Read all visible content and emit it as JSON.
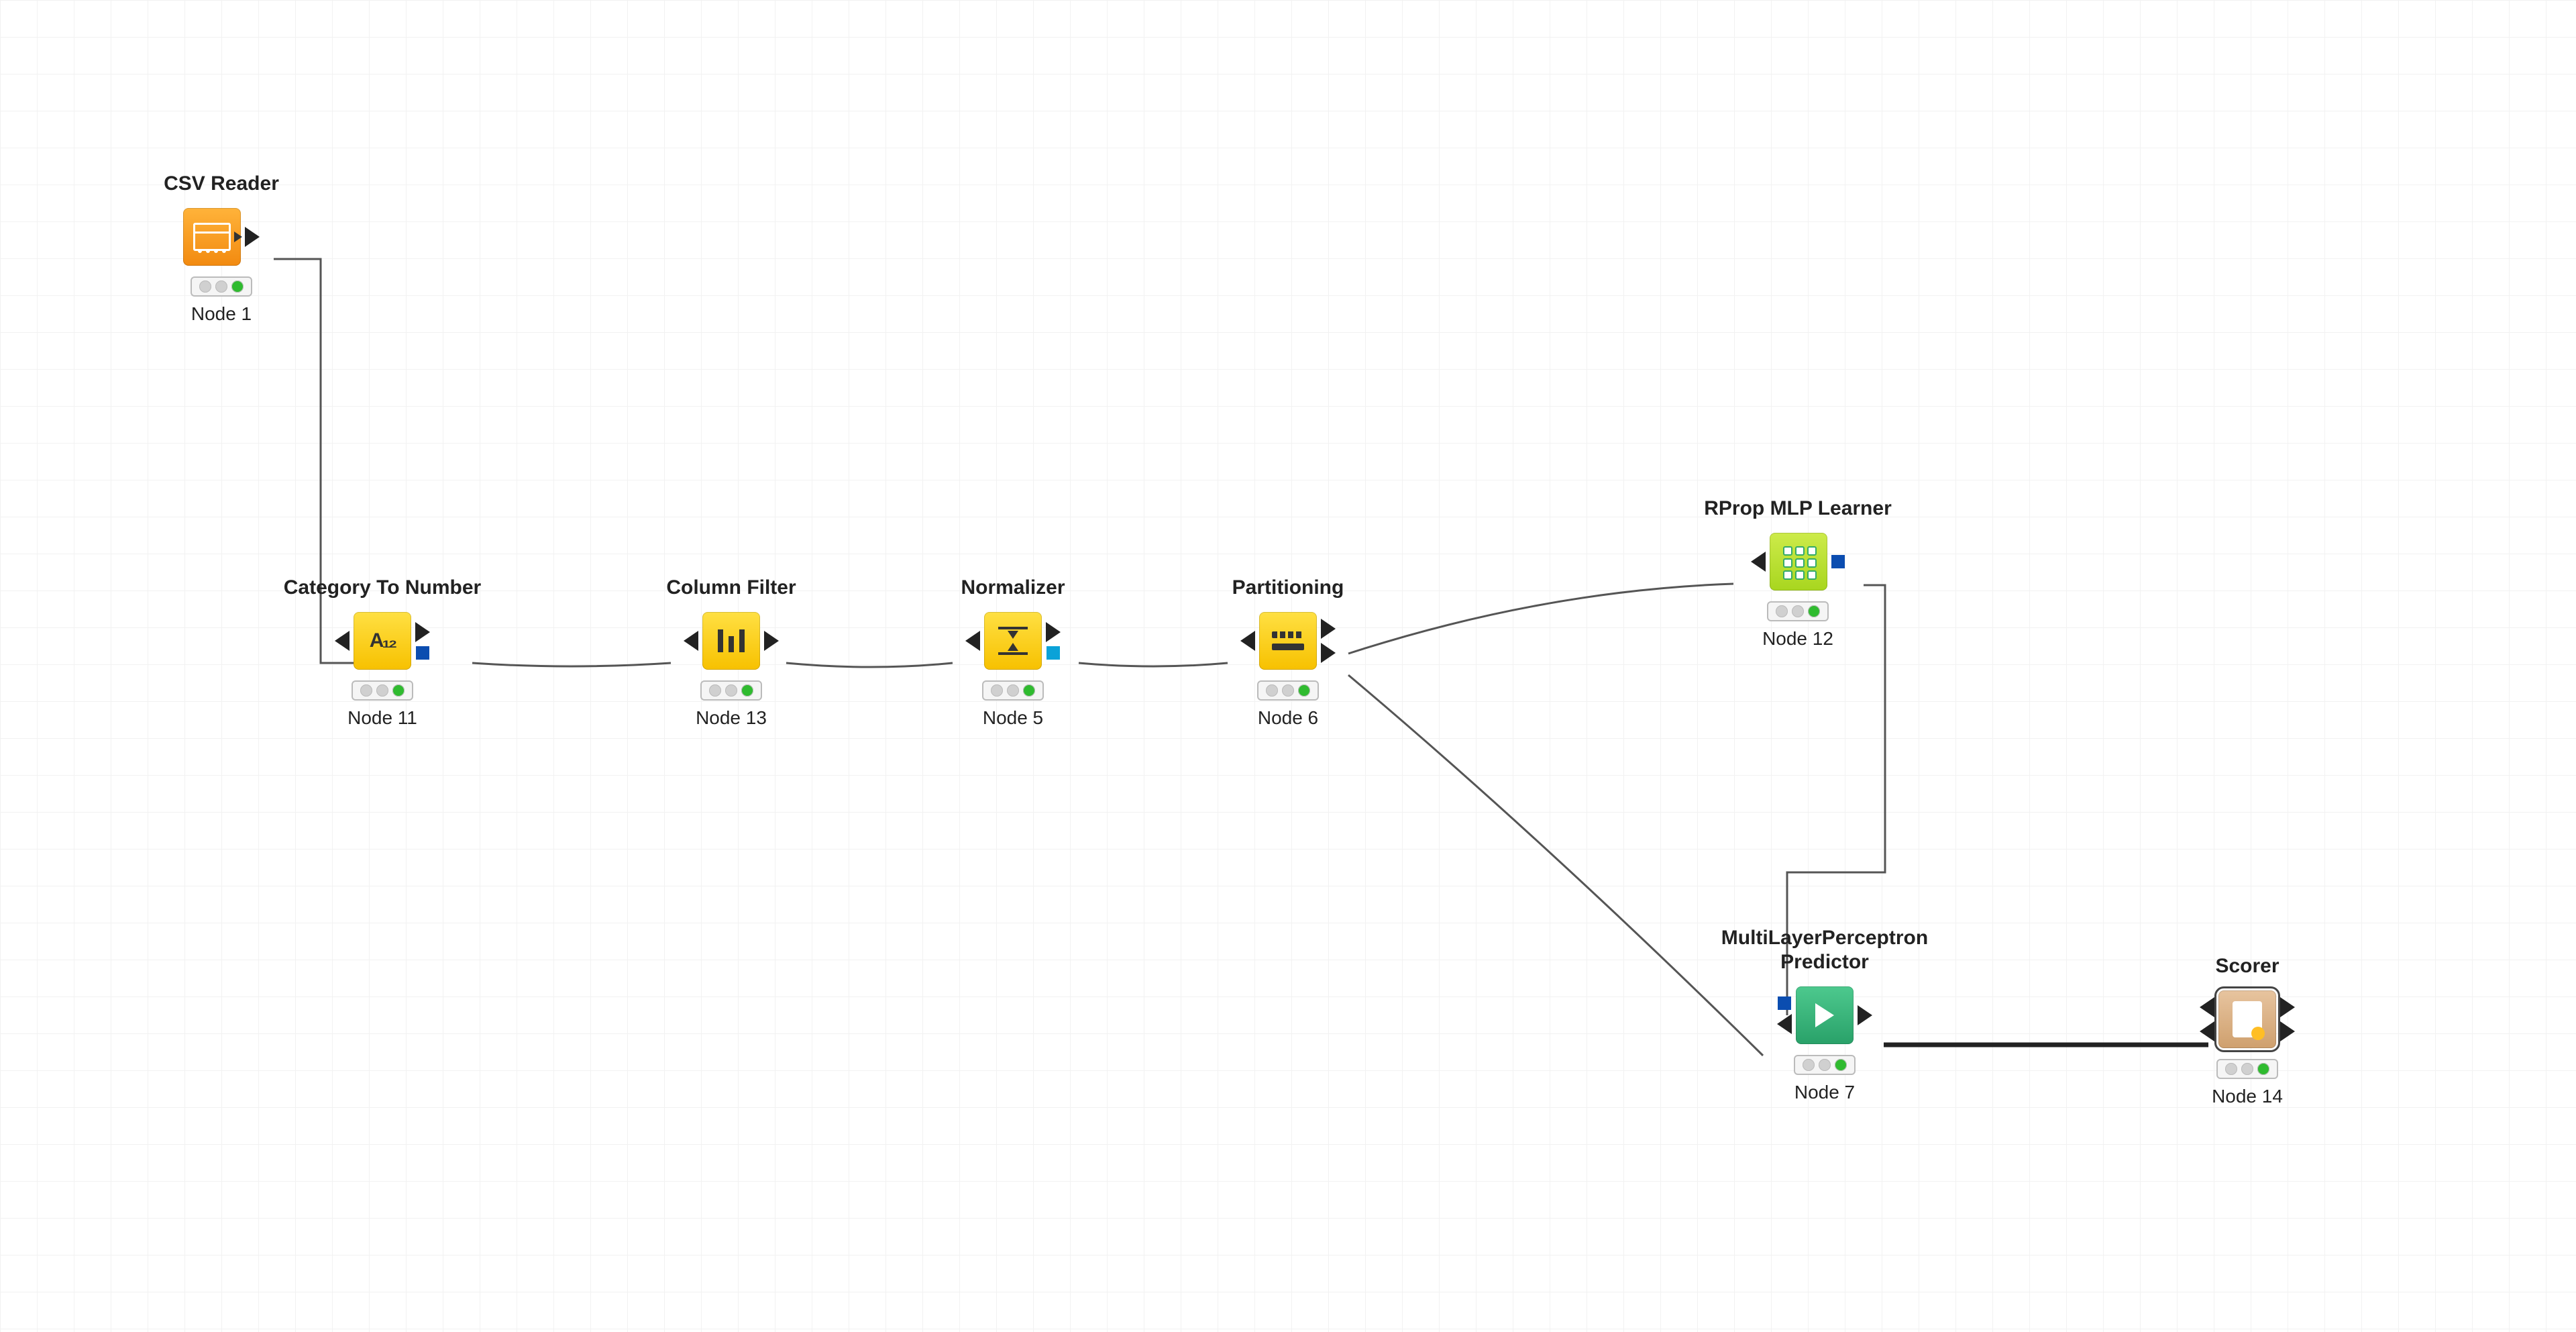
{
  "nodes": {
    "csv": {
      "title": "CSV Reader",
      "id": "Node 1"
    },
    "cat": {
      "title": "Category To Number",
      "id": "Node 11"
    },
    "colf": {
      "title": "Column Filter",
      "id": "Node 13"
    },
    "norm": {
      "title": "Normalizer",
      "id": "Node 5"
    },
    "part": {
      "title": "Partitioning",
      "id": "Node 6"
    },
    "rprop": {
      "title": "RProp MLP Learner",
      "id": "Node 12"
    },
    "mlp": {
      "title": "MultiLayerPerceptron Predictor",
      "id": "Node 7"
    },
    "scorer": {
      "title": "Scorer",
      "id": "Node 14"
    }
  }
}
